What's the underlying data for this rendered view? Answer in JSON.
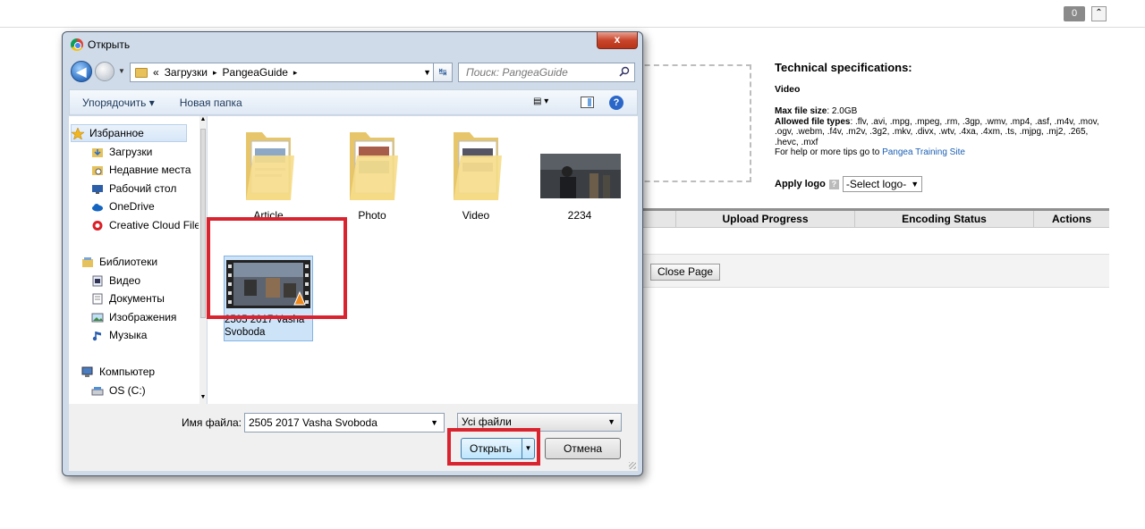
{
  "page": {
    "badge_count": "0",
    "collapse_glyph": "⌃",
    "specs": {
      "heading": "Technical specifications:",
      "section": "Video",
      "max_size_label": "Max file size",
      "max_size_value": ": 2.0GB",
      "allowed_label": "Allowed file types",
      "allowed_value": ": .flv, .avi, .mpg, .mpeg, .rm, .3gp, .wmv, .mp4, .asf, .m4v, .mov, .ogv, .webm, .f4v, .m2v, .3g2, .mkv, .divx, .wtv, .4xa, .4xm, .ts, .mjpg, .mj2, .265, .hevc, .mxf",
      "help_prefix": "For help or more tips go to ",
      "help_link": "Pangea Training Site"
    },
    "apply_logo_label": "Apply logo",
    "apply_logo_help": "?",
    "select_logo_value": "-Select logo-",
    "select_arrow": "▼",
    "table_columns": [
      "",
      "Upload Progress",
      "Encoding Status",
      "Actions"
    ],
    "close_page_label": "Close Page"
  },
  "dialog": {
    "title": "Открыть",
    "close_glyph": "x",
    "back_glyph": "◀",
    "address": {
      "chevrons": "«",
      "path": [
        "Загрузки",
        "PangeaGuide"
      ],
      "sep": "▸",
      "drop": "▼"
    },
    "refresh_glyph": "↹",
    "search_placeholder": "Поиск: PangeaGuide",
    "toolbar": {
      "organize": "Упорядочить ▾",
      "new_folder": "Новая папка",
      "view_glyph": "▤ ▾",
      "help_glyph": "?"
    },
    "nav": {
      "favorites": "Избранное",
      "fav_items": [
        "Загрузки",
        "Недавние места",
        "Рабочий стол",
        "OneDrive",
        "Creative Cloud Files"
      ],
      "libraries": "Библиотеки",
      "lib_items": [
        "Видео",
        "Документы",
        "Изображения",
        "Музыка"
      ],
      "computer": "Компьютер",
      "comp_items": [
        "OS (C:)"
      ],
      "scroll_up": "▲",
      "scroll_down": "▼"
    },
    "files": [
      {
        "name": "Article",
        "kind": "folder"
      },
      {
        "name": "Photo",
        "kind": "folder"
      },
      {
        "name": "Video",
        "kind": "folder"
      },
      {
        "name": "2234",
        "kind": "image"
      },
      {
        "name": "2505 2017 Vasha Svoboda",
        "kind": "video",
        "selected": true
      }
    ],
    "filename_label": "Имя файла:",
    "filename_value": "2505 2017 Vasha Svoboda",
    "filetype_value": "Усі файли",
    "dropdown_glyph": "▼",
    "open_label": "Открыть",
    "cancel_label": "Отмена"
  },
  "colors": {
    "highlight": "#d9232e",
    "dialog_frame": "#cfdbe9",
    "link": "#1a5fb4"
  }
}
